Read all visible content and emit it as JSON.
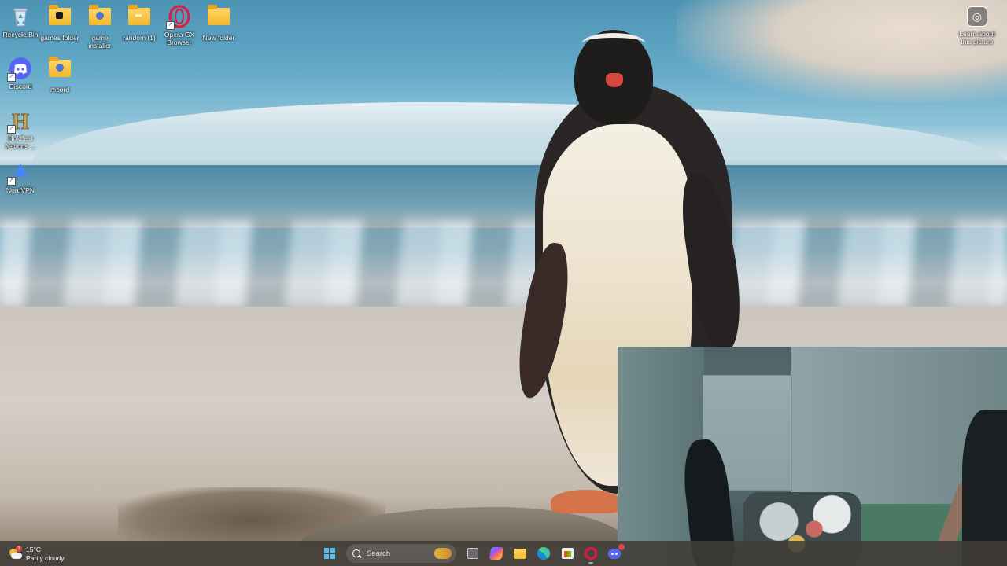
{
  "desktop": {
    "icons": [
      {
        "label": "Recycle Bin",
        "icon": "recycle-bin-icon"
      },
      {
        "label": "games folder",
        "icon": "folder-icon"
      },
      {
        "label": "game installer",
        "icon": "folder-icon"
      },
      {
        "label": "random (1)",
        "icon": "folder-icon"
      },
      {
        "label": "Opera GX Browser",
        "icon": "opera-gx-icon"
      },
      {
        "label": "New folder",
        "icon": "folder-icon"
      },
      {
        "label": "Discord",
        "icon": "discord-icon"
      },
      {
        "label": "record",
        "icon": "folder-icon"
      },
      {
        "label": "Holdfast Nations ...",
        "icon": "holdfast-icon"
      },
      {
        "label": "NordVPN",
        "icon": "nordvpn-icon"
      }
    ],
    "learn_about_picture": "Learn about this picture"
  },
  "taskbar": {
    "weather": {
      "temp": "15°C",
      "condition": "Partly cloudy",
      "badge": "1"
    },
    "search_placeholder": "Search",
    "apps": [
      "start-icon",
      "task-view-icon",
      "copilot-icon",
      "file-explorer-icon",
      "edge-icon",
      "microsoft-store-icon",
      "opera-gx-icon",
      "discord-icon"
    ]
  },
  "colors": {
    "taskbar_bg": "#3f3c37",
    "windows_blue": "#4cc2ff",
    "opera_red": "#e01a3c",
    "discord_blurple": "#5865f2"
  }
}
